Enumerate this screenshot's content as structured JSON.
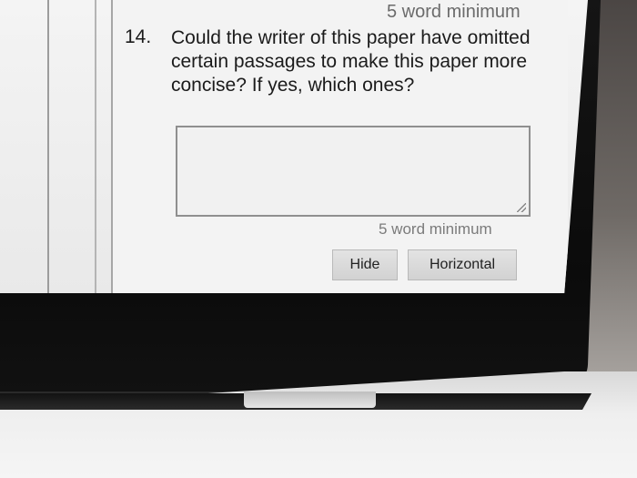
{
  "question": {
    "number": "14.",
    "text": "Could the writer of this paper have omitted certain passages to make this paper more concise? If yes, which ones?"
  },
  "hints": {
    "top_minimum": "5 word minimum",
    "bottom_minimum": "5 word minimum"
  },
  "answer": {
    "value": ""
  },
  "buttons": {
    "hide_label": "Hide",
    "horizontal_label": "Horizontal"
  }
}
